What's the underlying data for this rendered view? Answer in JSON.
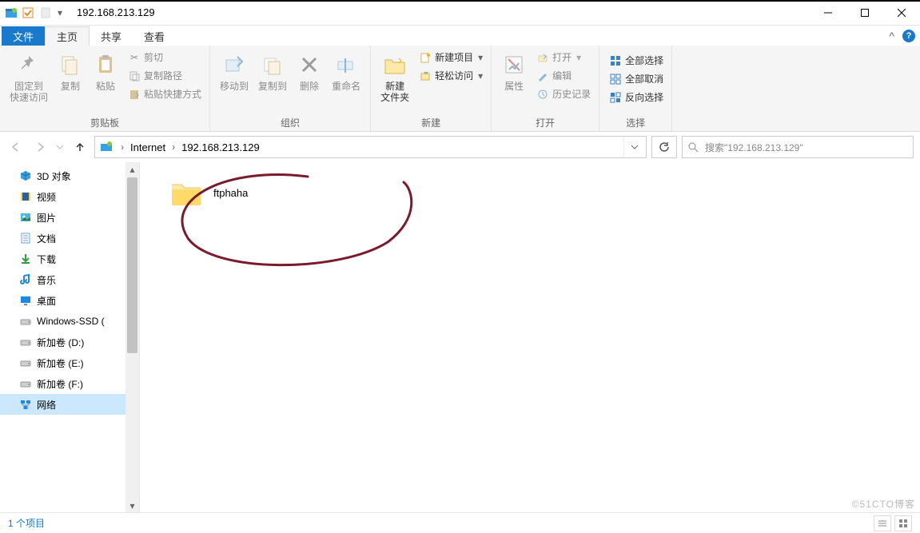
{
  "window": {
    "title": "192.168.213.129",
    "minimize": "–",
    "maximize": "□",
    "close": "✕"
  },
  "tabs": {
    "file": "文件",
    "home": "主页",
    "share": "共享",
    "view": "查看"
  },
  "ribbon": {
    "group_clipboard": "剪贴板",
    "group_organize": "组织",
    "group_new": "新建",
    "group_open": "打开",
    "group_select": "选择",
    "pin_to_quick": "固定到\n快速访问",
    "copy": "复制",
    "paste": "粘贴",
    "cut": "剪切",
    "copy_path": "复制路径",
    "paste_shortcut": "粘贴快捷方式",
    "move_to": "移动到",
    "copy_to": "复制到",
    "delete": "删除",
    "rename": "重命名",
    "new_folder": "新建\n文件夹",
    "new_item": "新建项目",
    "easy_access": "轻松访问",
    "properties": "属性",
    "open": "打开",
    "edit": "编辑",
    "history": "历史记录",
    "select_all": "全部选择",
    "select_none": "全部取消",
    "invert_sel": "反向选择"
  },
  "address": {
    "crumb1": "Internet",
    "crumb2": "192.168.213.129"
  },
  "search": {
    "placeholder": "搜索\"192.168.213.129\""
  },
  "nav": {
    "items": [
      {
        "label": "3D 对象",
        "icon": "cube"
      },
      {
        "label": "视频",
        "icon": "film"
      },
      {
        "label": "图片",
        "icon": "picture"
      },
      {
        "label": "文档",
        "icon": "doc"
      },
      {
        "label": "下载",
        "icon": "download"
      },
      {
        "label": "音乐",
        "icon": "music"
      },
      {
        "label": "桌面",
        "icon": "desktop"
      },
      {
        "label": "Windows-SSD (",
        "icon": "drive"
      },
      {
        "label": "新加卷 (D:)",
        "icon": "drive"
      },
      {
        "label": "新加卷 (E:)",
        "icon": "drive"
      },
      {
        "label": "新加卷 (F:)",
        "icon": "drive"
      },
      {
        "label": "网络",
        "icon": "network"
      }
    ]
  },
  "content": {
    "folder_name": "ftphaha"
  },
  "status": {
    "text": "1 个项目"
  },
  "watermark": "©51CTO博客"
}
